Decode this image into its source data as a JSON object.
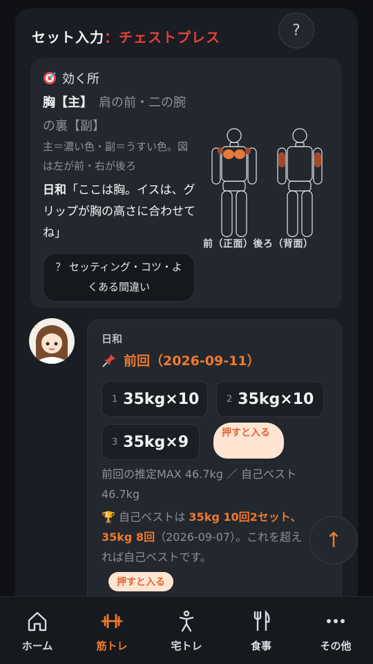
{
  "header": {
    "label": "セット入力",
    "separator": "：",
    "exercise": "チェストプレス",
    "help_label": "?"
  },
  "effect": {
    "heading": "効く所",
    "main_muscle": "胸【主】",
    "sub_muscle": "肩の前・二の腕の裏【副】",
    "legend": "主＝濃い色・副＝うすい色。図は左が前・右が後ろ",
    "hiyori_name": "日和",
    "hiyori_quote": "「ここは胸。イスは、グリップが胸の高さに合わせてね」",
    "tips_button": "？ セッティング・コツ・よくある間違い",
    "figure_caption": "前（正面）後ろ（背面）",
    "colors": {
      "primary": "#e8793a",
      "secondary": "#a04a2c"
    }
  },
  "chat": {
    "name": "日和",
    "prev_title": "前回（2026-09-11）",
    "sets": [
      {
        "no": "1",
        "value": "35kg×10"
      },
      {
        "no": "2",
        "value": "35kg×10"
      },
      {
        "no": "3",
        "value": "35kg×9"
      }
    ],
    "push_label": "押すと入る",
    "estimate": "前回の推定MAX 46.7kg ／ 自己ベスト 46.7kg",
    "best_prefix": "自己ベストは ",
    "best_highlight": "35kg 10回2セット、35kg 8回",
    "best_suffix": "（2026-09-07）。これを超えれば自己ベストです。",
    "push_label2": "押すと入る"
  },
  "scroll_top": "↑",
  "tabs": [
    {
      "label": "ホーム",
      "icon": "home-icon",
      "active": false
    },
    {
      "label": "筋トレ",
      "icon": "dumbbell-icon",
      "active": true
    },
    {
      "label": "宅トレ",
      "icon": "person-exercise-icon",
      "active": false
    },
    {
      "label": "食事",
      "icon": "fork-knife-icon",
      "active": false
    },
    {
      "label": "その他",
      "icon": "more-icon",
      "active": false
    }
  ],
  "accent": "#f07a2f"
}
